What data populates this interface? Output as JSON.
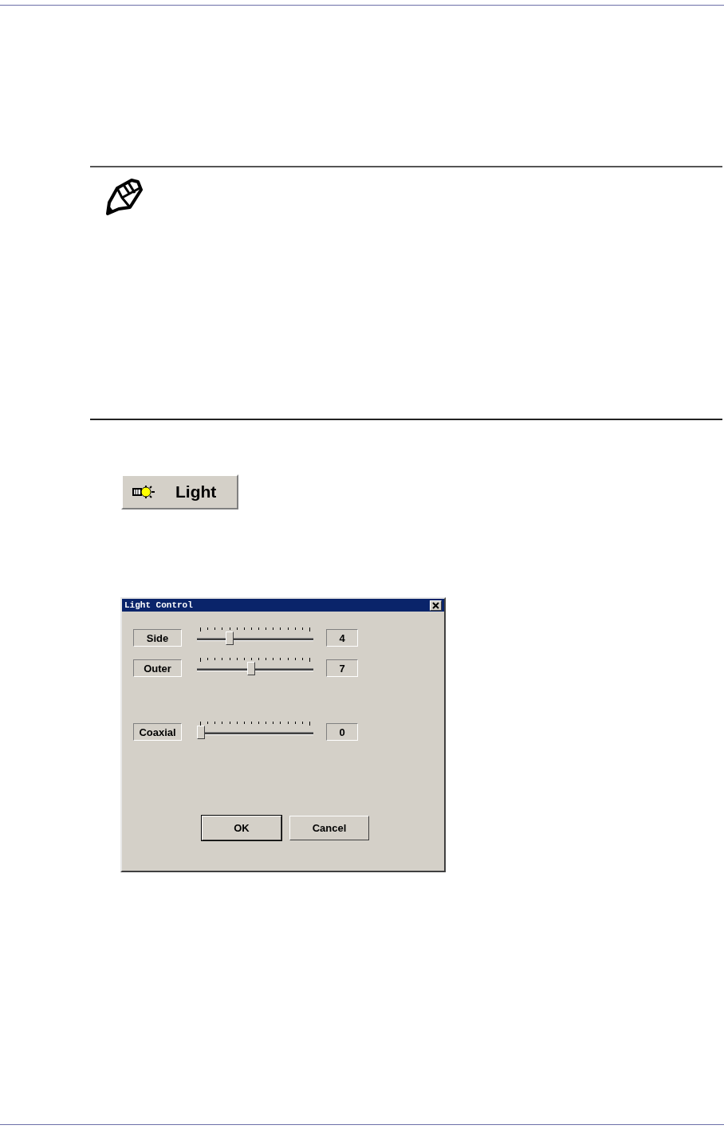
{
  "light_button": {
    "label": "Light"
  },
  "dialog": {
    "title": "Light Control",
    "sliders": [
      {
        "label": "Side",
        "level": 0.2667,
        "reading": "4"
      },
      {
        "label": "Outer",
        "level": 0.4667,
        "reading": "7"
      },
      {
        "label": "Coaxial",
        "level": 0,
        "reading": "0"
      }
    ],
    "buttons": [
      {
        "label": "OK",
        "default": true
      },
      {
        "label": "Cancel",
        "default": false
      }
    ]
  }
}
